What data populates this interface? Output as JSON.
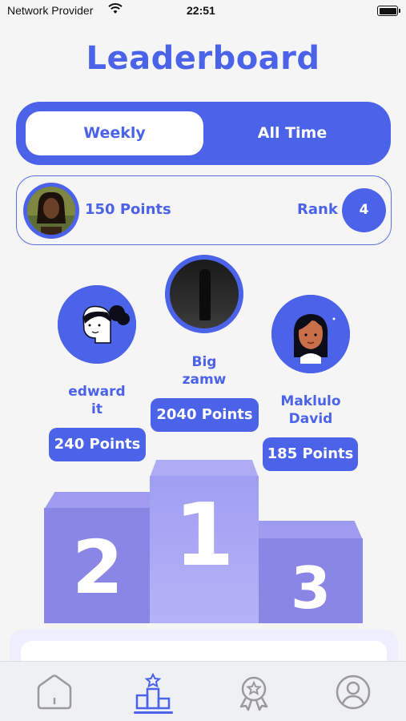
{
  "status_bar": {
    "carrier": "Network Provider",
    "time": "22:51"
  },
  "page": {
    "title": "Leaderboard"
  },
  "tabs": [
    {
      "label": "Weekly",
      "active": true
    },
    {
      "label": "All Time",
      "active": false
    }
  ],
  "current_user": {
    "points": "150 Points",
    "rank_label": "Rank",
    "rank": "4"
  },
  "podium": {
    "first": {
      "name": "Big\nzamw",
      "points": "2040 Points",
      "place": "1"
    },
    "second": {
      "name": "edward\nit",
      "points": "240 Points",
      "place": "2"
    },
    "third": {
      "name": "Maklulo\nDavid",
      "points": "185 Points",
      "place": "3"
    }
  },
  "bottom_nav": [
    {
      "icon": "home-icon",
      "active": false
    },
    {
      "icon": "leaderboard-icon",
      "active": true
    },
    {
      "icon": "badge-icon",
      "active": false
    },
    {
      "icon": "profile-icon",
      "active": false
    }
  ],
  "colors": {
    "accent": "#4a63e8",
    "podium_side": "#8a86e6",
    "podium_center": "#a09ef2",
    "background": "#f5f5f6"
  }
}
